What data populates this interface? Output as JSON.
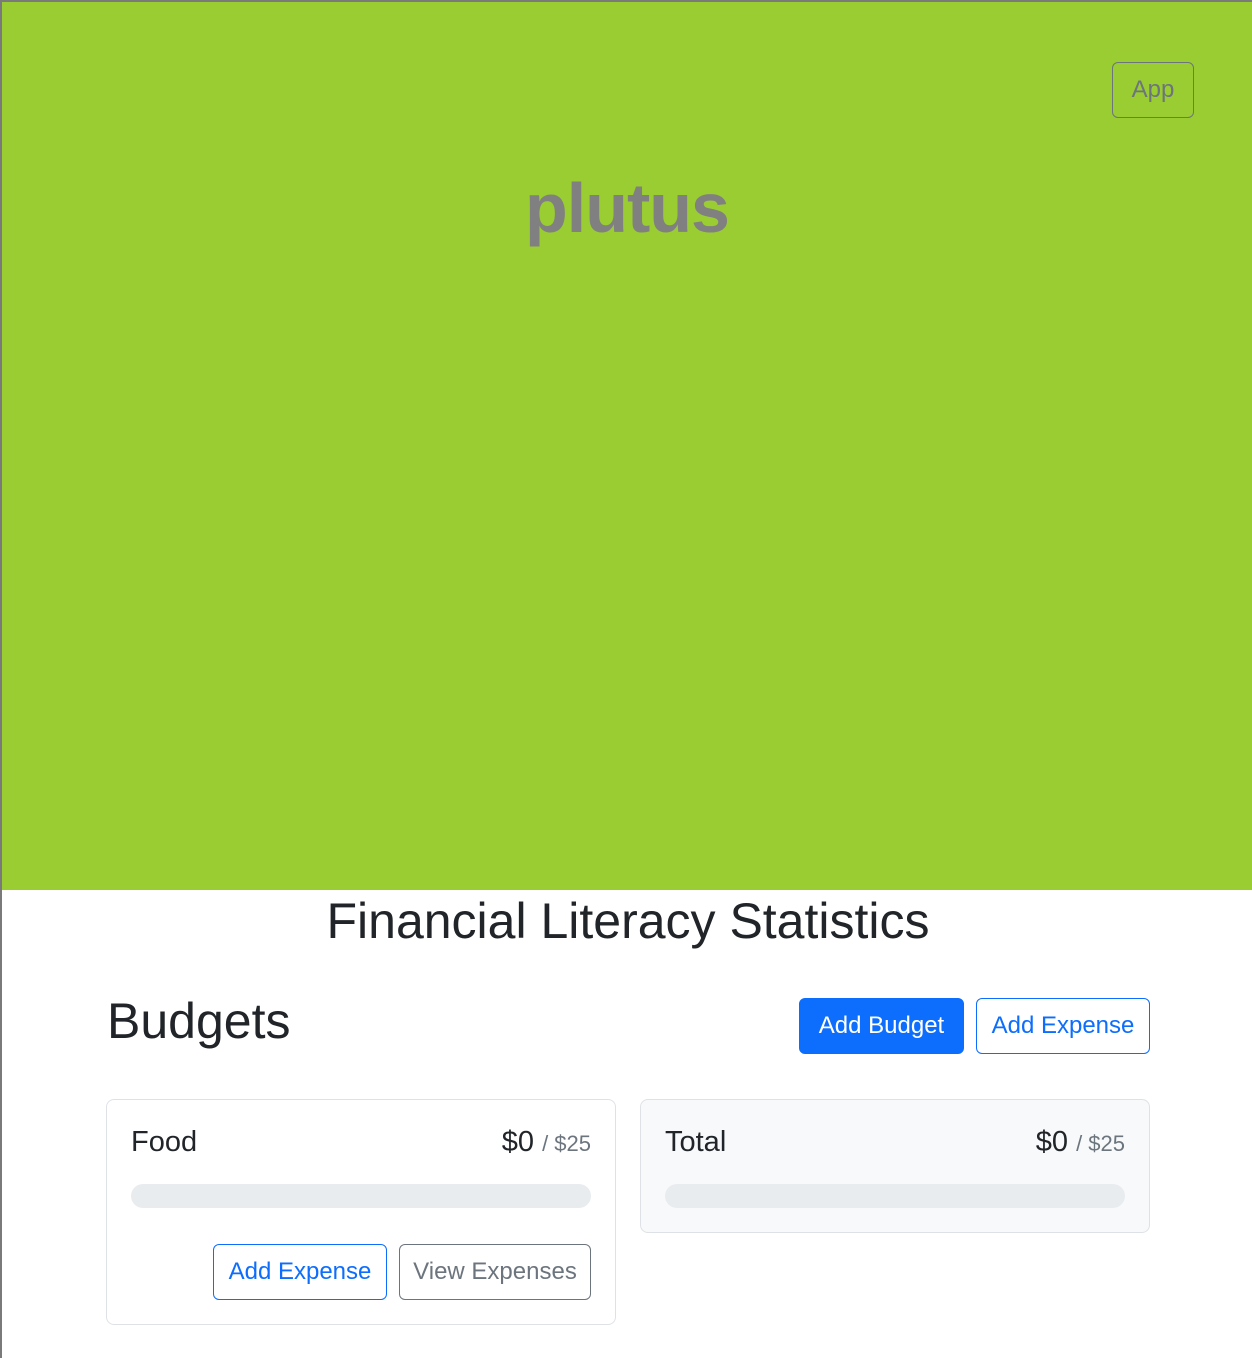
{
  "hero": {
    "brand": "plutus",
    "app_button": "App",
    "background_color": "#9acd32"
  },
  "stats_title": "Financial Literacy Statistics",
  "budgets": {
    "title": "Budgets",
    "add_budget_label": "Add Budget",
    "add_expense_label": "Add Expense",
    "cards": [
      {
        "name": "Food",
        "amount": "$0",
        "max": "/ $25",
        "progress": 0,
        "add_expense_label": "Add Expense",
        "view_expenses_label": "View Expenses"
      },
      {
        "name": "Total",
        "amount": "$0",
        "max": "/ $25",
        "progress": 0
      }
    ]
  },
  "colors": {
    "primary": "#0d6efd",
    "secondary": "#6c757d",
    "track": "#e9ecef"
  }
}
